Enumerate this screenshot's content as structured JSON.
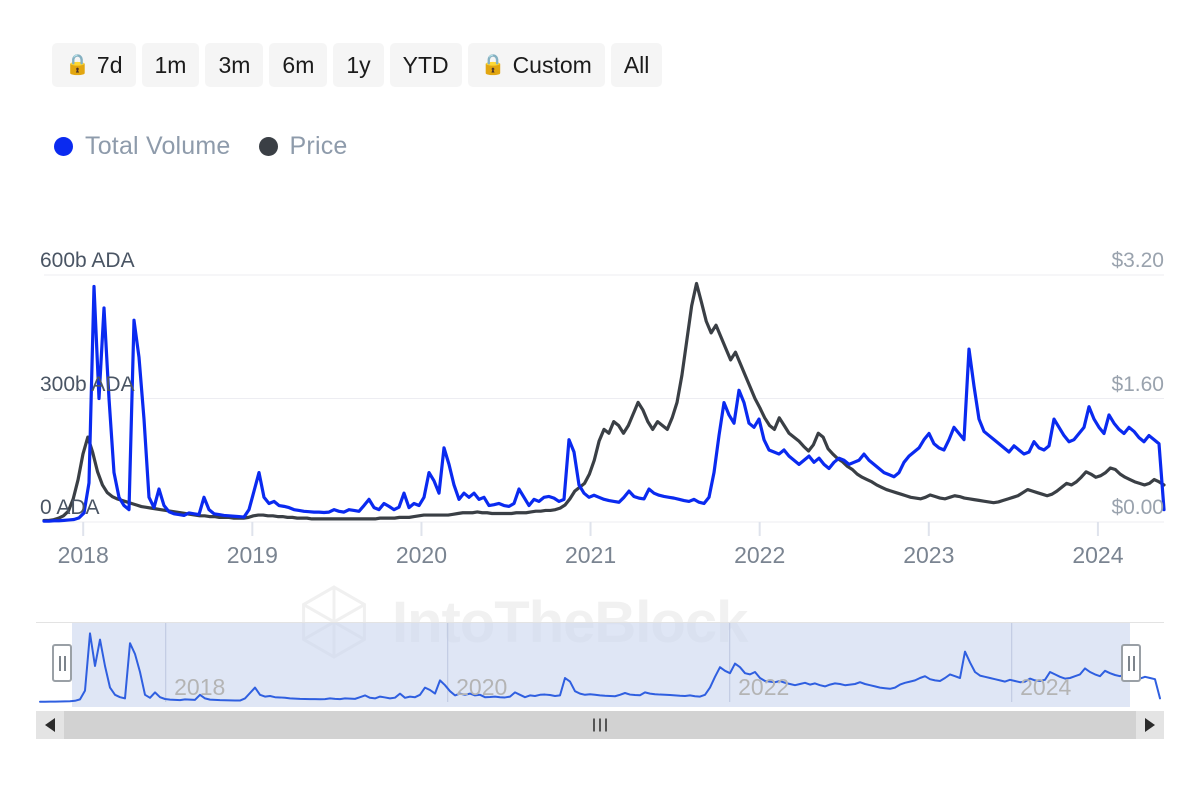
{
  "range_selector": {
    "buttons": [
      {
        "label": "7d",
        "locked": true,
        "icon": "lock-icon"
      },
      {
        "label": "1m",
        "locked": false,
        "icon": ""
      },
      {
        "label": "3m",
        "locked": false,
        "icon": ""
      },
      {
        "label": "6m",
        "locked": false,
        "icon": ""
      },
      {
        "label": "1y",
        "locked": false,
        "icon": ""
      },
      {
        "label": "YTD",
        "locked": false,
        "icon": ""
      },
      {
        "label": "Custom",
        "locked": true,
        "icon": "lock-icon"
      },
      {
        "label": "All",
        "locked": false,
        "icon": ""
      }
    ],
    "active": "All"
  },
  "legend": {
    "items": [
      {
        "label": "Total Volume",
        "color": "#0a2af0"
      },
      {
        "label": "Price",
        "color": "#3a3f45"
      }
    ]
  },
  "watermark": {
    "text": "IntoTheBlock",
    "logo_icon": "intotheblock-hex-logo"
  },
  "navigator": {
    "years": [
      "2018",
      "2020",
      "2022",
      "2024"
    ],
    "handle_left_label": "navigator-left-handle",
    "handle_right_label": "navigator-right-handle",
    "selection_start_pct": 3.2,
    "selection_end_pct": 97.0
  },
  "scrollbar": {
    "left_arrow": "◀",
    "right_arrow": "▶",
    "grip": "III"
  },
  "chart_data": {
    "type": "line",
    "title": "",
    "xlabel": "",
    "grid": true,
    "legend_position": "top-left",
    "x_ticks": [
      "2018",
      "2019",
      "2020",
      "2021",
      "2022",
      "2023",
      "2024"
    ],
    "x_tick_positions_pct": [
      3.5,
      18.6,
      33.7,
      48.8,
      63.9,
      79.0,
      94.1
    ],
    "x_range": [
      "2017-10",
      "2024-05"
    ],
    "axes": [
      {
        "id": "left",
        "label": "Total Volume",
        "unit": "ADA",
        "ticks": [
          "0 ADA",
          "300b ADA",
          "600b ADA"
        ],
        "tick_values": [
          0,
          300,
          600
        ],
        "ylim": [
          0,
          600
        ],
        "tick_suffix": "b ADA"
      },
      {
        "id": "right",
        "label": "Price",
        "unit": "USD",
        "ticks": [
          "$0.00",
          "$1.60",
          "$3.20"
        ],
        "tick_values": [
          0.0,
          1.6,
          3.2
        ],
        "ylim": [
          0,
          3.2
        ]
      }
    ],
    "series": [
      {
        "name": "Total Volume",
        "color": "#0a2af0",
        "axis": "left",
        "unit": "b ADA",
        "values": [
          2,
          2,
          3,
          3,
          4,
          5,
          6,
          10,
          22,
          95,
          572,
          300,
          520,
          300,
          120,
          60,
          40,
          30,
          490,
          400,
          250,
          60,
          35,
          80,
          40,
          25,
          20,
          18,
          16,
          22,
          20,
          18,
          60,
          30,
          20,
          18,
          16,
          15,
          14,
          13,
          12,
          30,
          75,
          120,
          60,
          45,
          50,
          40,
          38,
          35,
          30,
          28,
          26,
          25,
          24,
          24,
          23,
          24,
          30,
          26,
          24,
          30,
          28,
          26,
          40,
          55,
          35,
          30,
          45,
          38,
          30,
          36,
          70,
          35,
          45,
          40,
          60,
          120,
          100,
          70,
          180,
          140,
          90,
          55,
          70,
          60,
          70,
          55,
          60,
          40,
          42,
          45,
          40,
          38,
          45,
          80,
          60,
          40,
          55,
          50,
          60,
          62,
          58,
          50,
          55,
          200,
          170,
          90,
          70,
          60,
          65,
          60,
          55,
          52,
          50,
          48,
          60,
          75,
          62,
          58,
          56,
          80,
          70,
          65,
          62,
          60,
          58,
          55,
          52,
          50,
          55,
          48,
          45,
          60,
          120,
          210,
          290,
          260,
          240,
          320,
          290,
          240,
          230,
          250,
          200,
          175,
          170,
          165,
          175,
          160,
          150,
          140,
          150,
          160,
          145,
          155,
          140,
          130,
          145,
          155,
          150,
          140,
          145,
          150,
          165,
          150,
          140,
          130,
          120,
          115,
          110,
          120,
          145,
          160,
          170,
          180,
          200,
          215,
          190,
          180,
          175,
          200,
          230,
          215,
          200,
          420,
          330,
          250,
          220,
          210,
          200,
          190,
          180,
          170,
          185,
          175,
          165,
          170,
          195,
          180,
          175,
          185,
          250,
          230,
          210,
          195,
          200,
          215,
          230,
          280,
          250,
          230,
          215,
          260,
          240,
          225,
          215,
          230,
          220,
          205,
          195,
          210,
          200,
          190,
          30
        ]
      },
      {
        "name": "Price",
        "color": "#3a3f45",
        "axis": "right",
        "unit": "USD",
        "values": [
          0.02,
          0.02,
          0.03,
          0.05,
          0.08,
          0.14,
          0.3,
          0.55,
          0.88,
          1.1,
          0.9,
          0.65,
          0.48,
          0.38,
          0.33,
          0.3,
          0.28,
          0.26,
          0.24,
          0.22,
          0.2,
          0.19,
          0.18,
          0.17,
          0.16,
          0.15,
          0.14,
          0.13,
          0.12,
          0.11,
          0.1,
          0.09,
          0.08,
          0.08,
          0.07,
          0.07,
          0.06,
          0.06,
          0.06,
          0.05,
          0.05,
          0.05,
          0.06,
          0.08,
          0.09,
          0.09,
          0.08,
          0.08,
          0.07,
          0.07,
          0.06,
          0.06,
          0.05,
          0.05,
          0.05,
          0.04,
          0.04,
          0.04,
          0.04,
          0.04,
          0.04,
          0.04,
          0.04,
          0.04,
          0.04,
          0.04,
          0.04,
          0.04,
          0.04,
          0.05,
          0.05,
          0.05,
          0.05,
          0.06,
          0.06,
          0.06,
          0.07,
          0.08,
          0.09,
          0.09,
          0.09,
          0.09,
          0.09,
          0.09,
          0.1,
          0.11,
          0.12,
          0.12,
          0.12,
          0.13,
          0.12,
          0.12,
          0.11,
          0.11,
          0.11,
          0.11,
          0.11,
          0.12,
          0.12,
          0.12,
          0.13,
          0.14,
          0.14,
          0.15,
          0.15,
          0.16,
          0.18,
          0.22,
          0.3,
          0.4,
          0.45,
          0.5,
          0.62,
          0.8,
          1.05,
          1.2,
          1.15,
          1.3,
          1.25,
          1.15,
          1.25,
          1.4,
          1.55,
          1.45,
          1.3,
          1.2,
          1.3,
          1.25,
          1.2,
          1.35,
          1.55,
          1.9,
          2.35,
          2.8,
          3.09,
          2.85,
          2.6,
          2.45,
          2.55,
          2.4,
          2.25,
          2.1,
          2.2,
          2.05,
          1.9,
          1.75,
          1.6,
          1.48,
          1.35,
          1.25,
          1.2,
          1.35,
          1.25,
          1.15,
          1.1,
          1.05,
          0.98,
          0.92,
          1.0,
          1.15,
          1.1,
          0.95,
          0.88,
          0.82,
          0.78,
          0.72,
          0.68,
          0.62,
          0.58,
          0.55,
          0.52,
          0.48,
          0.45,
          0.42,
          0.4,
          0.38,
          0.36,
          0.34,
          0.32,
          0.31,
          0.3,
          0.32,
          0.35,
          0.33,
          0.31,
          0.3,
          0.32,
          0.34,
          0.33,
          0.31,
          0.3,
          0.29,
          0.28,
          0.27,
          0.26,
          0.25,
          0.26,
          0.28,
          0.3,
          0.32,
          0.34,
          0.38,
          0.42,
          0.4,
          0.38,
          0.36,
          0.34,
          0.36,
          0.4,
          0.45,
          0.5,
          0.48,
          0.52,
          0.58,
          0.65,
          0.62,
          0.58,
          0.6,
          0.64,
          0.7,
          0.68,
          0.62,
          0.58,
          0.55,
          0.52,
          0.5,
          0.48,
          0.5,
          0.55,
          0.52,
          0.48
        ]
      }
    ],
    "navigator_series": {
      "name": "Total Volume",
      "color": "#2f5fe0",
      "values": [
        2,
        2,
        3,
        3,
        4,
        5,
        6,
        10,
        22,
        95,
        572,
        300,
        520,
        300,
        120,
        60,
        40,
        30,
        490,
        400,
        250,
        60,
        35,
        80,
        40,
        25,
        20,
        18,
        16,
        22,
        20,
        18,
        60,
        30,
        20,
        18,
        16,
        15,
        14,
        13,
        12,
        30,
        75,
        120,
        60,
        45,
        50,
        40,
        38,
        35,
        30,
        28,
        26,
        25,
        24,
        24,
        23,
        24,
        30,
        26,
        24,
        30,
        28,
        26,
        40,
        55,
        35,
        30,
        45,
        38,
        30,
        36,
        70,
        35,
        45,
        40,
        60,
        120,
        100,
        70,
        180,
        140,
        90,
        55,
        70,
        60,
        70,
        55,
        60,
        40,
        42,
        45,
        40,
        38,
        45,
        80,
        60,
        40,
        55,
        50,
        60,
        62,
        58,
        50,
        55,
        200,
        170,
        90,
        70,
        60,
        65,
        60,
        55,
        52,
        50,
        48,
        60,
        75,
        62,
        58,
        56,
        80,
        70,
        65,
        62,
        60,
        58,
        55,
        52,
        50,
        55,
        48,
        45,
        60,
        120,
        210,
        290,
        260,
        240,
        320,
        290,
        240,
        230,
        250,
        200,
        175,
        170,
        165,
        175,
        160,
        150,
        140,
        150,
        160,
        145,
        155,
        140,
        130,
        145,
        155,
        150,
        140,
        145,
        150,
        165,
        150,
        140,
        130,
        120,
        115,
        110,
        120,
        145,
        160,
        170,
        180,
        200,
        215,
        190,
        180,
        175,
        200,
        230,
        215,
        200,
        420,
        330,
        250,
        220,
        210,
        200,
        190,
        180,
        170,
        185,
        175,
        165,
        170,
        195,
        180,
        175,
        185,
        250,
        230,
        210,
        195,
        200,
        215,
        230,
        280,
        250,
        230,
        215,
        260,
        240,
        225,
        215,
        230,
        220,
        205,
        195,
        210,
        200,
        190,
        30
      ]
    }
  }
}
